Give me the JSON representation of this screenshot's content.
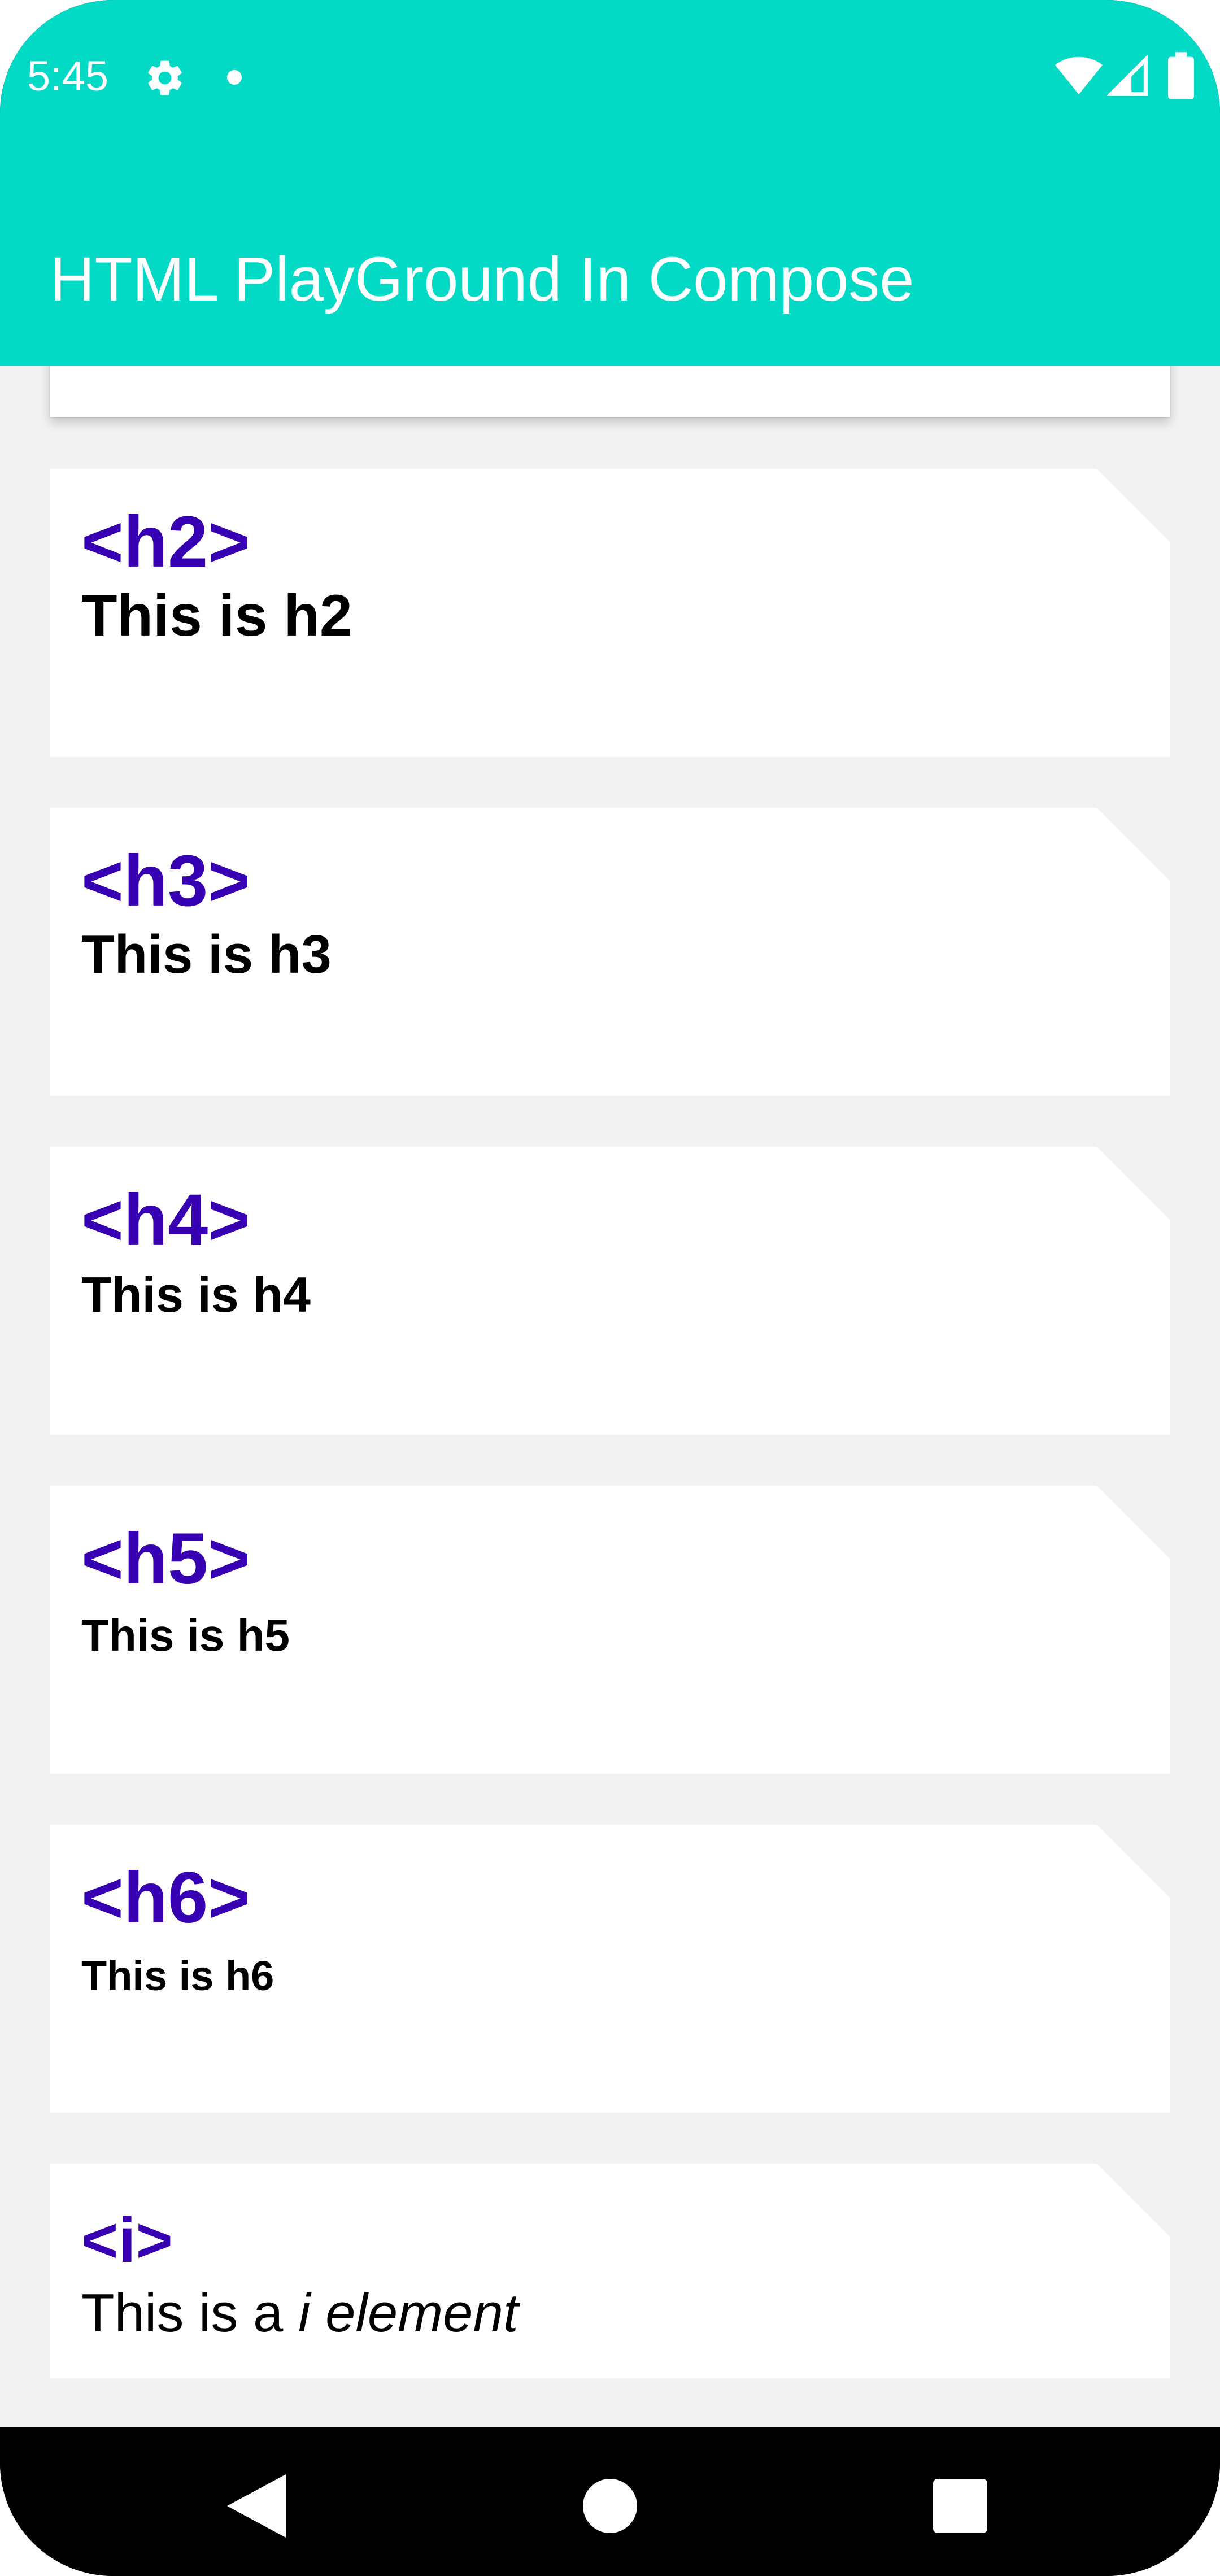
{
  "status_bar": {
    "time": "5:45",
    "icons": [
      "gear-icon",
      "notification-dot-icon",
      "wifi-icon",
      "cell-signal-icon",
      "battery-icon"
    ]
  },
  "app_bar": {
    "title": "HTML PlayGround In Compose",
    "background": "#03dac5"
  },
  "cards": [
    {
      "tag": "",
      "content": ""
    },
    {
      "tag": "<h2>",
      "content": "This is h2"
    },
    {
      "tag": "<h3>",
      "content": "This is h3"
    },
    {
      "tag": "<h4>",
      "content": "This is h4"
    },
    {
      "tag": "<h5>",
      "content": "This is h5"
    },
    {
      "tag": "<h6>",
      "content": "This is h6"
    },
    {
      "tag": "<i>",
      "content_prefix": "This is a ",
      "content_italic": "i element"
    }
  ],
  "colors": {
    "tag_color": "#3700b3",
    "content_color": "#000000",
    "list_background": "#f2f2f2",
    "card_background": "#ffffff"
  },
  "navigation_bar": {
    "buttons": [
      "back-icon",
      "home-icon",
      "recents-icon"
    ]
  }
}
